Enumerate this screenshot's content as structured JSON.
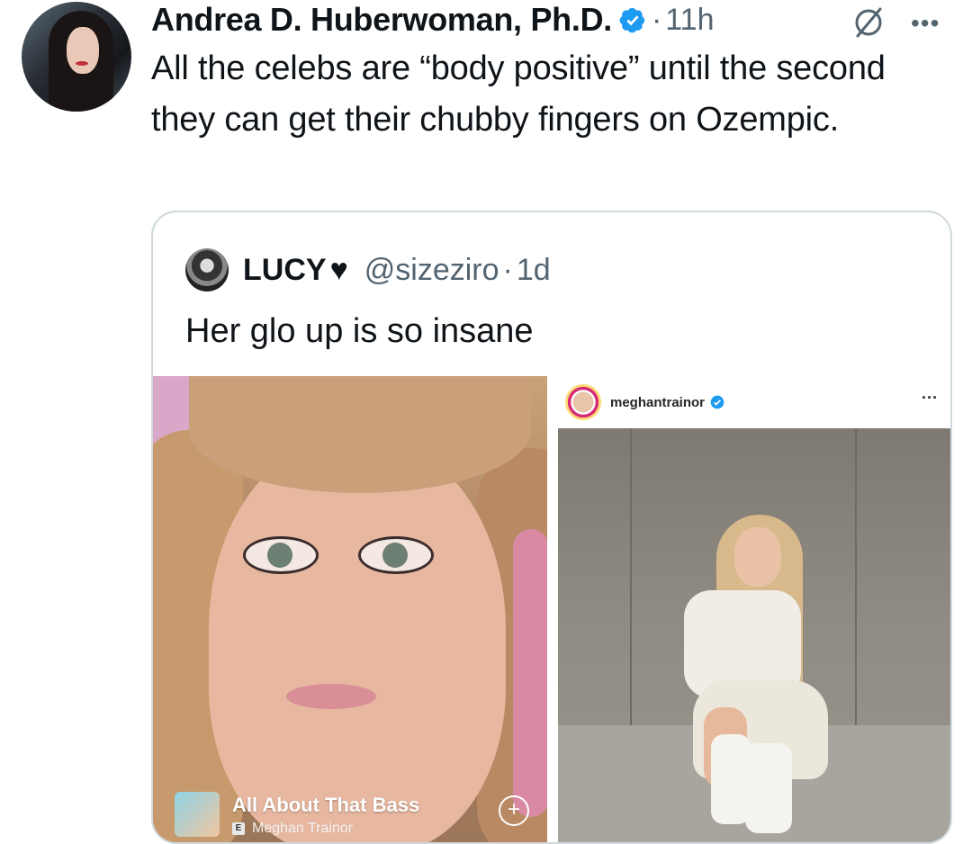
{
  "tweet": {
    "author_name": "Andrea D. Huberwoman, Ph.D.",
    "separator": "·",
    "time": "11h",
    "more_label": "•••",
    "text": "All the celebs are “body positive” until the second they can get their chubby fingers on Ozempic."
  },
  "quote": {
    "author_name": "LUCY",
    "heart": "♥",
    "handle": "@sizeziro",
    "separator": "·",
    "time": "1d",
    "text": "Her glo up is so insane"
  },
  "media_left": {
    "song_title": "All About That Bass",
    "explicit_badge": "E",
    "artist": "Meghan Trainor",
    "add_symbol": "+"
  },
  "media_right": {
    "ig_username": "meghantrainor",
    "more_label": "···"
  },
  "colors": {
    "verified_blue": "#1d9bf0",
    "text_primary": "#0f1419",
    "text_secondary": "#536471",
    "border": "#cfd9de"
  },
  "icons": [
    "verified-badge-icon",
    "grok-icon",
    "more-icon",
    "heart-icon",
    "explicit-icon",
    "add-icon",
    "ig-verified-icon"
  ]
}
